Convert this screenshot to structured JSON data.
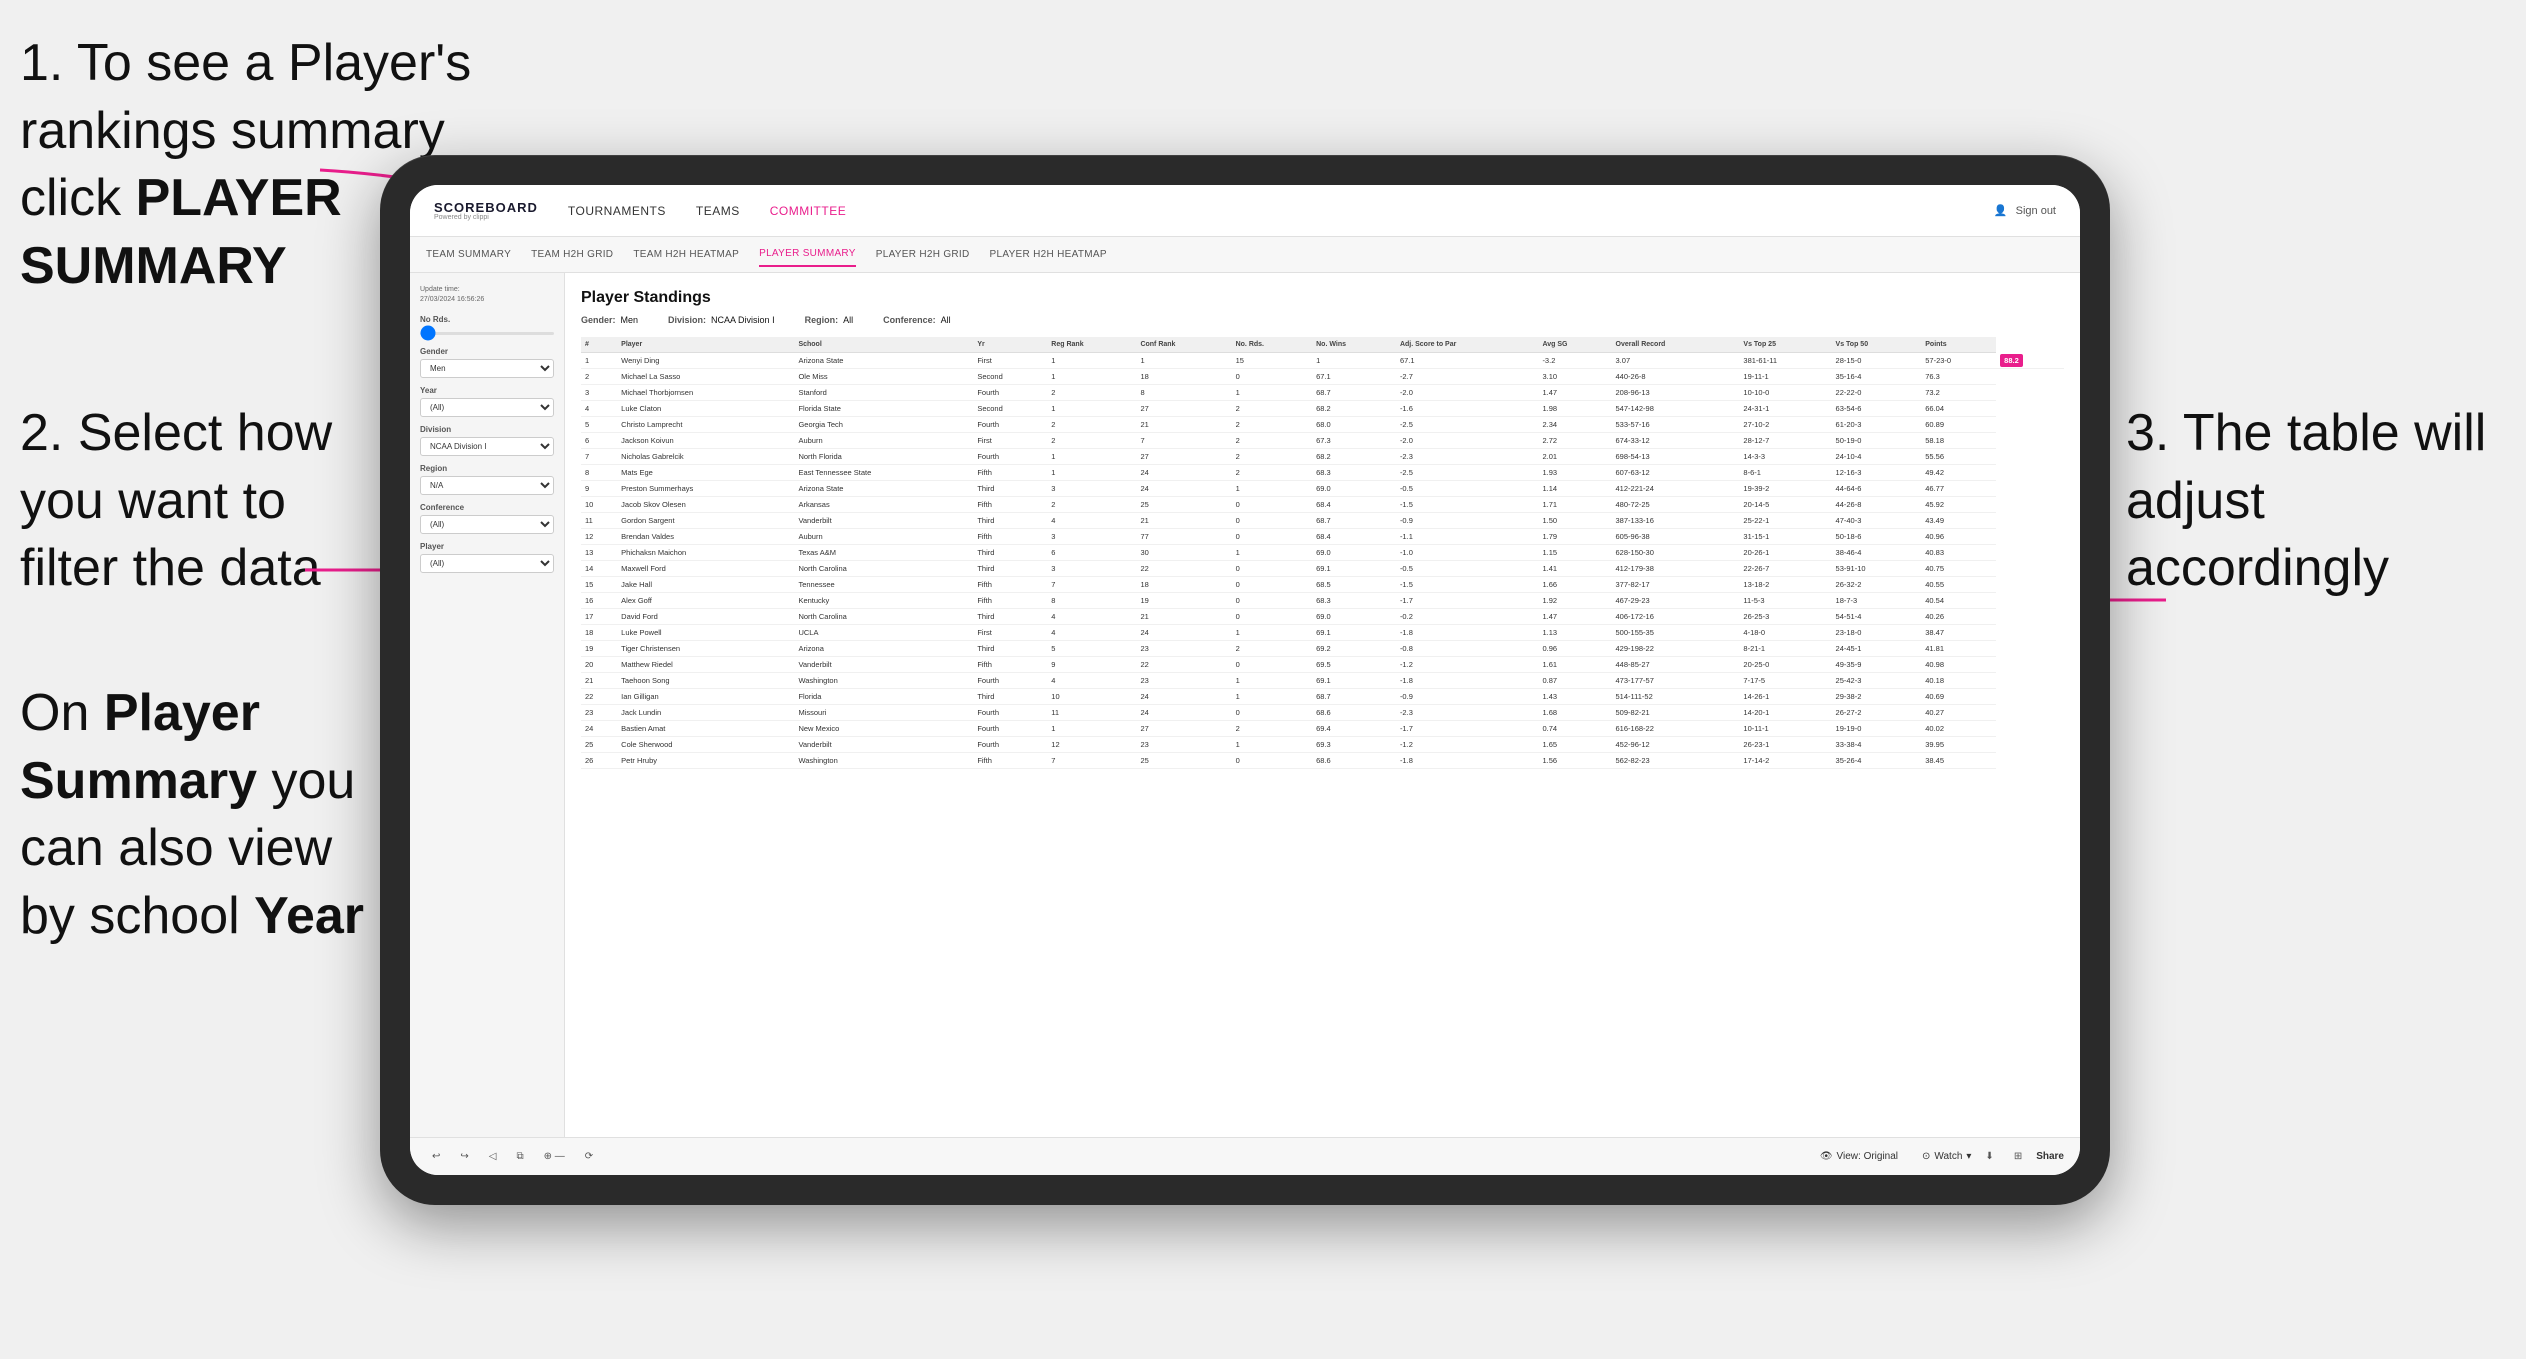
{
  "instructions": {
    "step1": "1. To see a Player's rankings summary click ",
    "step1_bold": "PLAYER SUMMARY",
    "step2_line1": "2. Select how",
    "step2_line2": "you want to",
    "step2_line3": "filter the data",
    "step3": "3. The table will adjust accordingly",
    "bottom_left_line1": "On ",
    "bottom_left_bold1": "Player",
    "bottom_left_line2": "Summary",
    "bottom_left_suffix": " you",
    "bottom_left_line3": "can also view",
    "bottom_left_line4": "by school ",
    "bottom_left_bold2": "Year"
  },
  "nav": {
    "logo_title": "SCOREBOARD",
    "logo_sub": "Powered by clippi",
    "links": [
      "TOURNAMENTS",
      "TEAMS",
      "COMMITTEE"
    ],
    "sign_out": "Sign out"
  },
  "sub_nav": {
    "links": [
      "TEAM SUMMARY",
      "TEAM H2H GRID",
      "TEAM H2H HEATMAP",
      "PLAYER SUMMARY",
      "PLAYER H2H GRID",
      "PLAYER H2H HEATMAP"
    ],
    "active": "PLAYER SUMMARY"
  },
  "sidebar": {
    "update_label": "Update time:",
    "update_time": "27/03/2024 16:56:26",
    "no_rds_label": "No Rds.",
    "gender_label": "Gender",
    "gender_value": "Men",
    "year_label": "Year",
    "year_value": "(All)",
    "division_label": "Division",
    "division_value": "NCAA Division I",
    "region_label": "Region",
    "region_value": "N/A",
    "conference_label": "Conference",
    "conference_value": "(All)",
    "player_label": "Player",
    "player_value": "(All)"
  },
  "table": {
    "title": "Player Standings",
    "filters": {
      "gender_label": "Gender:",
      "gender_value": "Men",
      "division_label": "Division:",
      "division_value": "NCAA Division I",
      "region_label": "Region:",
      "region_value": "All",
      "conference_label": "Conference:",
      "conference_value": "All"
    },
    "columns": [
      "#",
      "Player",
      "School",
      "Yr",
      "Reg Rank",
      "Conf Rank",
      "No. Rds.",
      "No. Wins",
      "Adj. Score to Par",
      "Avg SG",
      "Overall Record",
      "Vs Top 25",
      "Vs Top 50",
      "Points"
    ],
    "rows": [
      [
        "1",
        "Wenyi Ding",
        "Arizona State",
        "First",
        "1",
        "1",
        "15",
        "1",
        "67.1",
        "-3.2",
        "3.07",
        "381-61-11",
        "28-15-0",
        "57-23-0",
        "88.2"
      ],
      [
        "2",
        "Michael La Sasso",
        "Ole Miss",
        "Second",
        "1",
        "18",
        "0",
        "67.1",
        "-2.7",
        "3.10",
        "440-26-8",
        "19-11-1",
        "35-16-4",
        "76.3"
      ],
      [
        "3",
        "Michael Thorbjornsen",
        "Stanford",
        "Fourth",
        "2",
        "8",
        "1",
        "68.7",
        "-2.0",
        "1.47",
        "208-96-13",
        "10-10-0",
        "22-22-0",
        "73.2"
      ],
      [
        "4",
        "Luke Claton",
        "Florida State",
        "Second",
        "1",
        "27",
        "2",
        "68.2",
        "-1.6",
        "1.98",
        "547-142-98",
        "24-31-1",
        "63-54-6",
        "66.04"
      ],
      [
        "5",
        "Christo Lamprecht",
        "Georgia Tech",
        "Fourth",
        "2",
        "21",
        "2",
        "68.0",
        "-2.5",
        "2.34",
        "533-57-16",
        "27-10-2",
        "61-20-3",
        "60.89"
      ],
      [
        "6",
        "Jackson Koivun",
        "Auburn",
        "First",
        "2",
        "7",
        "2",
        "67.3",
        "-2.0",
        "2.72",
        "674-33-12",
        "28-12-7",
        "50-19-0",
        "58.18"
      ],
      [
        "7",
        "Nicholas Gabrelcik",
        "North Florida",
        "Fourth",
        "1",
        "27",
        "2",
        "68.2",
        "-2.3",
        "2.01",
        "698-54-13",
        "14-3-3",
        "24-10-4",
        "55.56"
      ],
      [
        "8",
        "Mats Ege",
        "East Tennessee State",
        "Fifth",
        "1",
        "24",
        "2",
        "68.3",
        "-2.5",
        "1.93",
        "607-63-12",
        "8-6-1",
        "12-16-3",
        "49.42"
      ],
      [
        "9",
        "Preston Summerhays",
        "Arizona State",
        "Third",
        "3",
        "24",
        "1",
        "69.0",
        "-0.5",
        "1.14",
        "412-221-24",
        "19-39-2",
        "44-64-6",
        "46.77"
      ],
      [
        "10",
        "Jacob Skov Olesen",
        "Arkansas",
        "Fifth",
        "2",
        "25",
        "0",
        "68.4",
        "-1.5",
        "1.71",
        "480-72-25",
        "20-14-5",
        "44-26-8",
        "45.92"
      ],
      [
        "11",
        "Gordon Sargent",
        "Vanderbilt",
        "Third",
        "4",
        "21",
        "0",
        "68.7",
        "-0.9",
        "1.50",
        "387-133-16",
        "25-22-1",
        "47-40-3",
        "43.49"
      ],
      [
        "12",
        "Brendan Valdes",
        "Auburn",
        "Fifth",
        "3",
        "77",
        "0",
        "68.4",
        "-1.1",
        "1.79",
        "605-96-38",
        "31-15-1",
        "50-18-6",
        "40.96"
      ],
      [
        "13",
        "Phichaksn Maichon",
        "Texas A&M",
        "Third",
        "6",
        "30",
        "1",
        "69.0",
        "-1.0",
        "1.15",
        "628-150-30",
        "20-26-1",
        "38-46-4",
        "40.83"
      ],
      [
        "14",
        "Maxwell Ford",
        "North Carolina",
        "Third",
        "3",
        "22",
        "0",
        "69.1",
        "-0.5",
        "1.41",
        "412-179-38",
        "22-26-7",
        "53-91-10",
        "40.75"
      ],
      [
        "15",
        "Jake Hall",
        "Tennessee",
        "Fifth",
        "7",
        "18",
        "0",
        "68.5",
        "-1.5",
        "1.66",
        "377-82-17",
        "13-18-2",
        "26-32-2",
        "40.55"
      ],
      [
        "16",
        "Alex Goff",
        "Kentucky",
        "Fifth",
        "8",
        "19",
        "0",
        "68.3",
        "-1.7",
        "1.92",
        "467-29-23",
        "11-5-3",
        "18-7-3",
        "40.54"
      ],
      [
        "17",
        "David Ford",
        "North Carolina",
        "Third",
        "4",
        "21",
        "0",
        "69.0",
        "-0.2",
        "1.47",
        "406-172-16",
        "26-25-3",
        "54-51-4",
        "40.26"
      ],
      [
        "18",
        "Luke Powell",
        "UCLA",
        "First",
        "4",
        "24",
        "1",
        "69.1",
        "-1.8",
        "1.13",
        "500-155-35",
        "4-18-0",
        "23-18-0",
        "38.47"
      ],
      [
        "19",
        "Tiger Christensen",
        "Arizona",
        "Third",
        "5",
        "23",
        "2",
        "69.2",
        "-0.8",
        "0.96",
        "429-198-22",
        "8-21-1",
        "24-45-1",
        "41.81"
      ],
      [
        "20",
        "Matthew Riedel",
        "Vanderbilt",
        "Fifth",
        "9",
        "22",
        "0",
        "69.5",
        "-1.2",
        "1.61",
        "448-85-27",
        "20-25-0",
        "49-35-9",
        "40.98"
      ],
      [
        "21",
        "Taehoon Song",
        "Washington",
        "Fourth",
        "4",
        "23",
        "1",
        "69.1",
        "-1.8",
        "0.87",
        "473-177-57",
        "7-17-5",
        "25-42-3",
        "40.18"
      ],
      [
        "22",
        "Ian Gilligan",
        "Florida",
        "Third",
        "10",
        "24",
        "1",
        "68.7",
        "-0.9",
        "1.43",
        "514-111-52",
        "14-26-1",
        "29-38-2",
        "40.69"
      ],
      [
        "23",
        "Jack Lundin",
        "Missouri",
        "Fourth",
        "11",
        "24",
        "0",
        "68.6",
        "-2.3",
        "1.68",
        "509-82-21",
        "14-20-1",
        "26-27-2",
        "40.27"
      ],
      [
        "24",
        "Bastien Amat",
        "New Mexico",
        "Fourth",
        "1",
        "27",
        "2",
        "69.4",
        "-1.7",
        "0.74",
        "616-168-22",
        "10-11-1",
        "19-19-0",
        "40.02"
      ],
      [
        "25",
        "Cole Sherwood",
        "Vanderbilt",
        "Fourth",
        "12",
        "23",
        "1",
        "69.3",
        "-1.2",
        "1.65",
        "452-96-12",
        "26-23-1",
        "33-38-4",
        "39.95"
      ],
      [
        "26",
        "Petr Hruby",
        "Washington",
        "Fifth",
        "7",
        "25",
        "0",
        "68.6",
        "-1.8",
        "1.56",
        "562-82-23",
        "17-14-2",
        "35-26-4",
        "38.45"
      ]
    ]
  },
  "toolbar": {
    "view_label": "View: Original",
    "watch_label": "Watch",
    "share_label": "Share"
  }
}
